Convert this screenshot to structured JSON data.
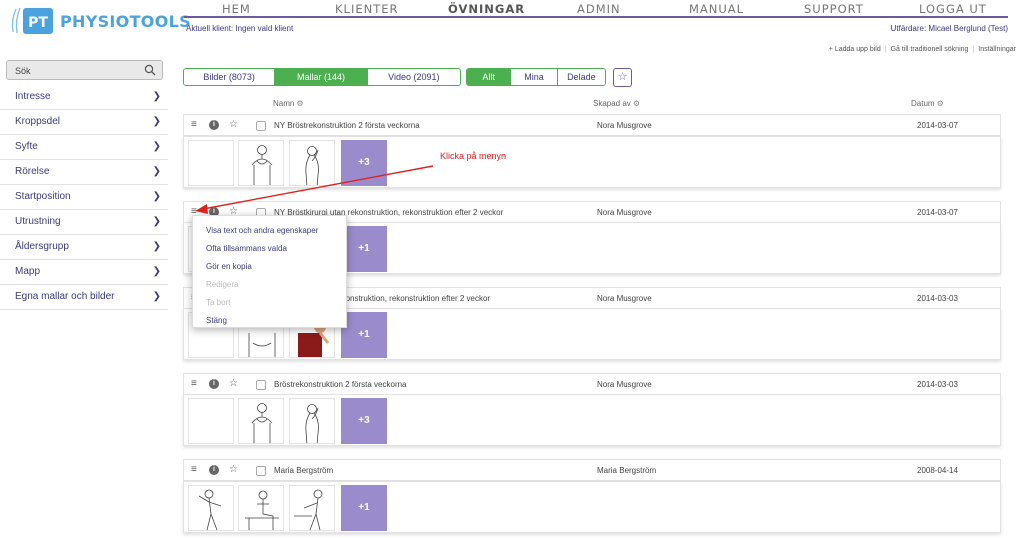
{
  "brand": {
    "logo_mark": "PT",
    "name": "PHYSIOTOOLS",
    "accent": "#4aa3df"
  },
  "nav": {
    "items": [
      "HEM",
      "KLIENTER",
      "ÖVNINGAR",
      "ADMIN",
      "MANUAL",
      "SUPPORT",
      "LOGGA UT"
    ],
    "active": "ÖVNINGAR"
  },
  "client_bar": {
    "current_client": "Aktuell klient: Ingen vald klient",
    "issuer": "Utfärdare: Micael Berglund (Test)"
  },
  "top_links": [
    "+ Ladda upp bild",
    "Gå till traditionell sökning",
    "Inställningar"
  ],
  "sidebar": {
    "search_label": "Sök",
    "items": [
      "Intresse",
      "Kroppsdel",
      "Syfte",
      "Rörelse",
      "Startposition",
      "Utrustning",
      "Åldersgrupp",
      "Mapp",
      "Egna mallar och bilder"
    ]
  },
  "filters": {
    "types": [
      {
        "label": "Bilder (8073)",
        "active": false
      },
      {
        "label": "Mallar (144)",
        "active": true
      },
      {
        "label": "Video (2091)",
        "active": false
      }
    ],
    "ownership": [
      {
        "label": "Allt",
        "active": true
      },
      {
        "label": "Mina",
        "active": false
      },
      {
        "label": "Delade",
        "active": false
      }
    ],
    "favorite_icon": "star-outline-icon"
  },
  "columns": {
    "name": "Namn",
    "created_by": "Skapad av",
    "date": "Datum"
  },
  "rows": [
    {
      "name": "NY Bröstrekonstruktion 2 första veckorna",
      "author": "Nora Musgrove",
      "date": "2014-03-07",
      "more": "+3"
    },
    {
      "name": "NY Bröstkirurgi utan rekonstruktion, rekonstruktion efter 2 veckor",
      "author": "Nora Musgrove",
      "date": "2014-03-07",
      "more": "+1"
    },
    {
      "name": "Bröstkirurgi utan rekonstruktion, rekonstruktion efter 2 veckor",
      "author": "Nora Musgrove",
      "date": "2014-03-03",
      "more": "+1"
    },
    {
      "name": "Bröstrekonstruktion 2 första veckorna",
      "author": "Nora Musgrove",
      "date": "2014-03-03",
      "more": "+3"
    },
    {
      "name": "Maria Bergström",
      "author": "Maria Bergström",
      "date": "2008-04-14",
      "more": "+1"
    }
  ],
  "context_menu": {
    "items": [
      {
        "label": "Visa text och andra egenskaper",
        "enabled": true
      },
      {
        "label": "Ofta tillsammans valda",
        "enabled": true
      },
      {
        "label": "Gör en kopia",
        "enabled": true
      },
      {
        "label": "Redigera",
        "enabled": false
      },
      {
        "label": "Ta bort",
        "enabled": false
      },
      {
        "label": "Stäng",
        "enabled": true
      }
    ]
  },
  "annotation": {
    "text": "Klicka på menyn",
    "color": "#e0201d"
  },
  "colors": {
    "nav_underline": "#6b5b9e",
    "green": "#4caf50",
    "purple_tile": "#9a8ccc",
    "link": "#3d3a80"
  }
}
